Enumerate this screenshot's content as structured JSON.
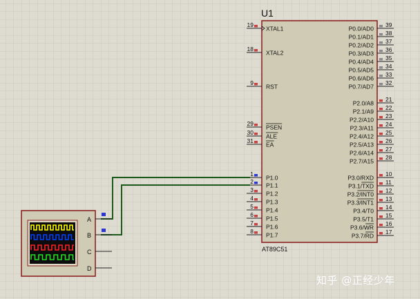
{
  "mcu": {
    "ref": "U1",
    "part": "AT89C51",
    "left_pins": [
      {
        "num": "19",
        "label": "XTAL1",
        "clock": true
      },
      {
        "num": "18",
        "label": "XTAL2"
      },
      {
        "num": "9",
        "label": "RST"
      },
      {
        "num": "29",
        "label": "PSEN",
        "overbar": true
      },
      {
        "num": "30",
        "label": "ALE",
        "overbar": true
      },
      {
        "num": "31",
        "label": "EA",
        "overbar": true
      },
      {
        "num": "1",
        "label": "P1.0"
      },
      {
        "num": "2",
        "label": "P1.1"
      },
      {
        "num": "3",
        "label": "P1.2"
      },
      {
        "num": "4",
        "label": "P1.3"
      },
      {
        "num": "5",
        "label": "P1.4"
      },
      {
        "num": "6",
        "label": "P1.5"
      },
      {
        "num": "7",
        "label": "P1.6"
      },
      {
        "num": "8",
        "label": "P1.7"
      }
    ],
    "right_pins": [
      {
        "num": "39",
        "label": "P0.0/AD0"
      },
      {
        "num": "38",
        "label": "P0.1/AD1"
      },
      {
        "num": "37",
        "label": "P0.2/AD2"
      },
      {
        "num": "36",
        "label": "P0.3/AD3"
      },
      {
        "num": "35",
        "label": "P0.4/AD4"
      },
      {
        "num": "34",
        "label": "P0.5/AD5"
      },
      {
        "num": "33",
        "label": "P0.6/AD6"
      },
      {
        "num": "32",
        "label": "P0.7/AD7"
      },
      {
        "num": "21",
        "label": "P2.0/A8"
      },
      {
        "num": "22",
        "label": "P2.1/A9"
      },
      {
        "num": "23",
        "label": "P2.2/A10"
      },
      {
        "num": "24",
        "label": "P2.3/A11"
      },
      {
        "num": "25",
        "label": "P2.4/A12"
      },
      {
        "num": "26",
        "label": "P2.5/A13"
      },
      {
        "num": "27",
        "label": "P2.6/A14"
      },
      {
        "num": "28",
        "label": "P2.7/A15"
      },
      {
        "num": "10",
        "label": "P3.0/RXD"
      },
      {
        "num": "11",
        "label": "P3.1/",
        "over": "TXD"
      },
      {
        "num": "12",
        "label": "P3.2/",
        "over": "INT0"
      },
      {
        "num": "13",
        "label": "P3.3/",
        "over": "INT1"
      },
      {
        "num": "14",
        "label": "P3.4/T0"
      },
      {
        "num": "15",
        "label": "P3.5/T1"
      },
      {
        "num": "16",
        "label": "P3.6/",
        "over": "WR"
      },
      {
        "num": "17",
        "label": "P3.7/",
        "over": "RD"
      }
    ]
  },
  "scope": {
    "channels": [
      "A",
      "B",
      "C",
      "D"
    ],
    "trace_colors": [
      "#ffff00",
      "#0040ff",
      "#ff2020",
      "#20e020"
    ]
  },
  "watermark": "知乎 @正经少年",
  "colors": {
    "background": "#dedcd0",
    "grid": "#c7c5b8",
    "component_fill": "#cfcbb4",
    "outline": "#8b2424",
    "wire": "#1a5a1a",
    "pin_marker": "#c84040",
    "pin_marker_gray": "#8a8a8a",
    "probe": "#2a36d8"
  }
}
